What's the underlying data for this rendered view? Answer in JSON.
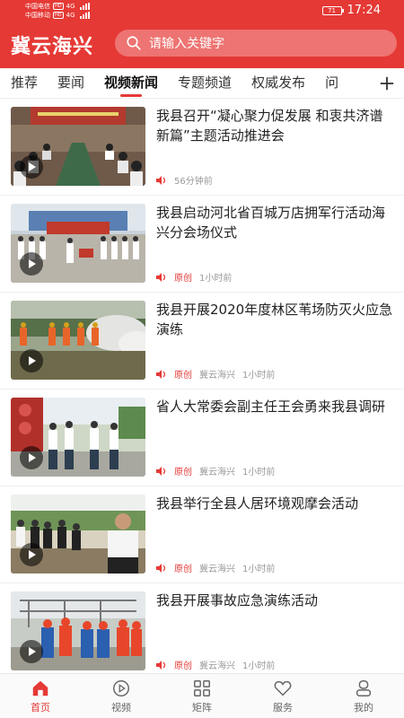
{
  "status_bar": {
    "carrier1": "中国电信",
    "carrier2": "中国移动",
    "hd_badge": "HD",
    "net1": "4G",
    "net2": "4G",
    "battery": "71",
    "time": "17:24"
  },
  "header": {
    "logo": "冀云海兴",
    "search_placeholder": "请输入关键字"
  },
  "tabs": [
    "推荐",
    "要闻",
    "视频新闻",
    "专题频道",
    "权威发布",
    "问"
  ],
  "active_tab": "视频新闻",
  "news": [
    {
      "title": "我县召开“凝心聚力促发展 和衷共济谱新篇”主题活动推进会",
      "original": "",
      "source": "",
      "time": "56分钟前"
    },
    {
      "title": "我县启动河北省百城万店拥军行活动海兴分会场仪式",
      "original": "原创",
      "source": "",
      "time": "1小时前"
    },
    {
      "title": "我县开展2020年度林区苇场防灭火应急演练",
      "original": "原创",
      "source": "冀云海兴",
      "time": "1小时前"
    },
    {
      "title": "省人大常委会副主任王会勇来我县调研",
      "original": "原创",
      "source": "冀云海兴",
      "time": "1小时前"
    },
    {
      "title": "我县举行全县人居环境观摩会活动",
      "original": "原创",
      "source": "冀云海兴",
      "time": "1小时前"
    },
    {
      "title": "我县开展事故应急演练活动",
      "original": "原创",
      "source": "冀云海兴",
      "time": "1小时前"
    }
  ],
  "bottom_nav": [
    {
      "label": "首页",
      "icon": "home-icon",
      "active": true
    },
    {
      "label": "视频",
      "icon": "video-icon",
      "active": false
    },
    {
      "label": "矩阵",
      "icon": "grid-icon",
      "active": false
    },
    {
      "label": "服务",
      "icon": "heart-icon",
      "active": false
    },
    {
      "label": "我的",
      "icon": "user-icon",
      "active": false
    }
  ],
  "colors": {
    "accent": "#e53935"
  }
}
